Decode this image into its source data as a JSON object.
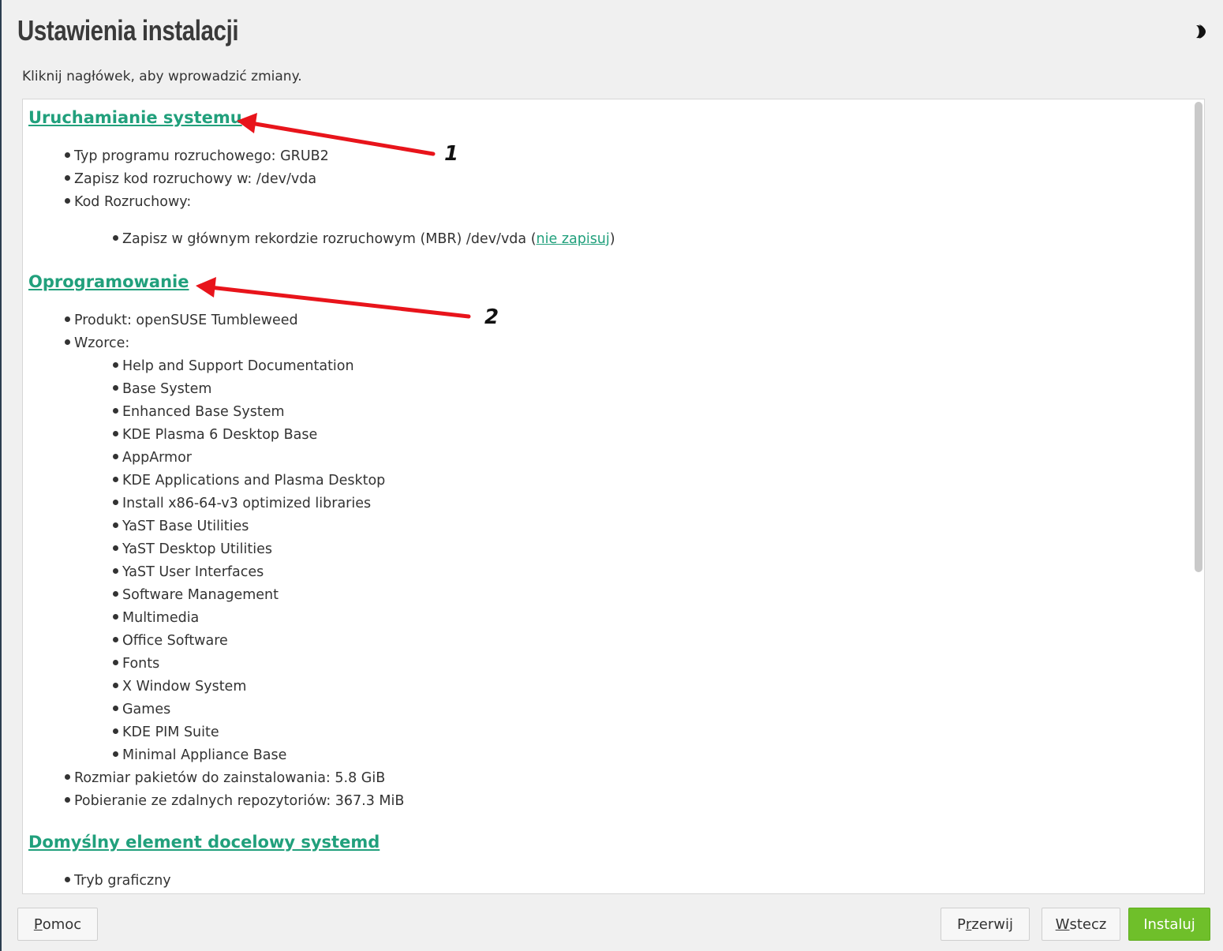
{
  "header": {
    "title": "Ustawienia instalacji",
    "subtitle": "Kliknij nagłówek, aby wprowadzić zmiany.",
    "theme_icon": "half-moon-icon"
  },
  "sections": {
    "boot": {
      "heading": "Uruchamianie systemu",
      "items": [
        "Typ programu rozruchowego: GRUB2",
        "Zapisz kod rozruchowy w: /dev/vda",
        "Kod Rozruchowy:"
      ],
      "sub_item_prefix": "Zapisz w głównym rekordzie rozruchowym (MBR) /dev/vda (",
      "sub_item_link": "nie zapisuj",
      "sub_item_suffix": ")"
    },
    "software": {
      "heading": "Oprogramowanie",
      "product": "Produkt: openSUSE Tumbleweed",
      "patterns_label": "Wzorce:",
      "patterns": [
        "Help and Support Documentation",
        "Base System",
        "Enhanced Base System",
        "KDE Plasma 6 Desktop Base",
        "AppArmor",
        "KDE Applications and Plasma Desktop",
        "Install x86-64-v3 optimized libraries",
        "YaST Base Utilities",
        "YaST Desktop Utilities",
        "YaST User Interfaces",
        "Software Management",
        "Multimedia",
        "Office Software",
        "Fonts",
        "X Window System",
        "Games",
        "KDE PIM Suite",
        "Minimal Appliance Base"
      ],
      "size": "Rozmiar pakietów do zainstalowania: 5.8 GiB",
      "download": "Pobieranie ze zdalnych repozytoriów: 367.3 MiB"
    },
    "systemd": {
      "heading": "Domyślny element docelowy systemd",
      "items": [
        "Tryb graficzny"
      ]
    }
  },
  "annotations": {
    "arrow1_label": "1",
    "arrow2_label": "2",
    "color": "#e8141b"
  },
  "buttons": {
    "help_key": "P",
    "help_rest": "omoc",
    "abort_pre": "P",
    "abort_key": "r",
    "abort_rest": "zerwij",
    "back_key": "W",
    "back_rest": "stecz",
    "install": "Instaluj"
  },
  "colors": {
    "link": "#21a07c",
    "install_button": "#6fbf2a"
  }
}
